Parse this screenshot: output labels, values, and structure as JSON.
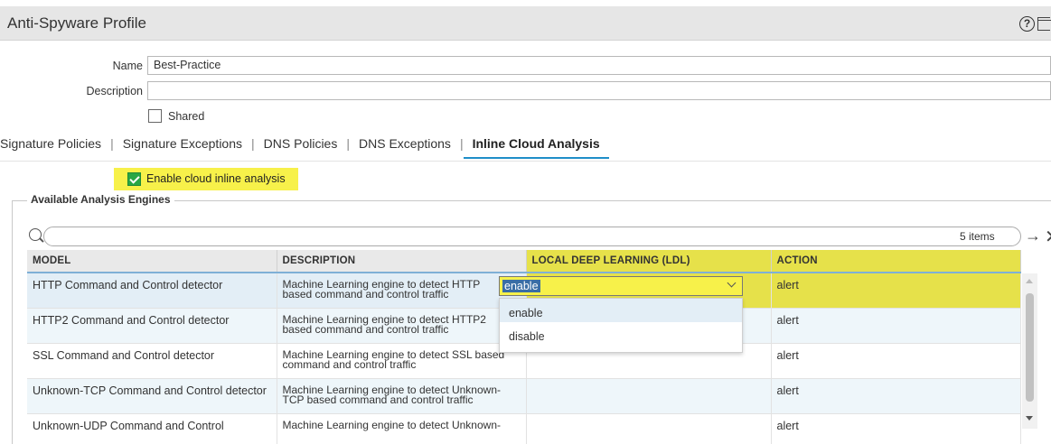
{
  "window": {
    "title": "Anti-Spyware Profile"
  },
  "form": {
    "name_label": "Name",
    "name_value": "Best-Practice",
    "description_label": "Description",
    "description_value": "",
    "shared_label": "Shared",
    "shared_checked": false
  },
  "tabs": [
    {
      "label": "Signature Policies",
      "active": false
    },
    {
      "label": "Signature Exceptions",
      "active": false
    },
    {
      "label": "DNS Policies",
      "active": false
    },
    {
      "label": "DNS Exceptions",
      "active": false
    },
    {
      "label": "Inline Cloud Analysis",
      "active": true
    }
  ],
  "tab_separator": "|",
  "inline": {
    "enable_label": "Enable cloud inline analysis",
    "enable_checked": true,
    "section_title": "Available Analysis Engines"
  },
  "search": {
    "value": "",
    "items_count": "5 items"
  },
  "table": {
    "headers": [
      "MODEL",
      "DESCRIPTION",
      "LOCAL DEEP LEARNING (LDL)",
      "ACTION"
    ],
    "rows": [
      {
        "model": "HTTP Command and Control detector",
        "desc1": "Machine Learning engine to detect HTTP",
        "desc2": "based command and control traffic",
        "ldl": "enable",
        "action": "alert"
      },
      {
        "model": "HTTP2 Command and Control detector",
        "desc1": "Machine Learning engine to detect HTTP2",
        "desc2": "based command and control traffic",
        "ldl": "",
        "action": "alert"
      },
      {
        "model": "SSL Command and Control detector",
        "desc1": "Machine Learning engine to detect SSL based",
        "desc2": "command and control traffic",
        "ldl": "",
        "action": "alert"
      },
      {
        "model": "Unknown-TCP Command and Control detector",
        "desc1": "Machine Learning engine to detect Unknown-",
        "desc2": "TCP based command and control traffic",
        "ldl": "",
        "action": "alert"
      },
      {
        "model": "Unknown-UDP Command and Control",
        "desc1": "Machine Learning engine to detect Unknown-",
        "desc2": "",
        "ldl": "",
        "action": "alert"
      }
    ]
  },
  "ldl_dropdown": {
    "selected": "enable",
    "options": [
      "enable",
      "disable"
    ]
  },
  "colors": {
    "highlight": "#f7f14a",
    "accent": "#1f8ec8",
    "checkbox_green": "#28a745"
  },
  "icons": {
    "help": "help-icon",
    "maximize": "maximize-icon",
    "search": "search-icon",
    "apply": "arrow-right-icon",
    "clear": "close-icon"
  }
}
